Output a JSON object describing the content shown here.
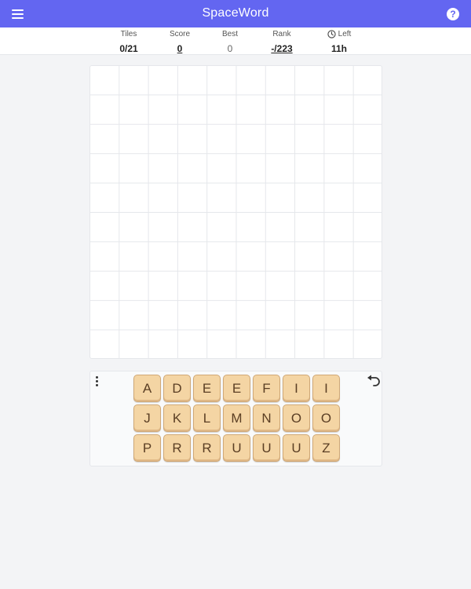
{
  "app": {
    "title": "SpaceWord",
    "header_color": "#6366f1",
    "menu_icon": "hamburger-menu-icon",
    "help_icon": "help-circle-icon",
    "help_glyph": "?"
  },
  "stats": {
    "tiles": {
      "label": "Tiles",
      "value": "0/21"
    },
    "score": {
      "label": "Score",
      "value": "0"
    },
    "best": {
      "label": "Best",
      "value": "0"
    },
    "rank": {
      "label": "Rank",
      "value": "-/223"
    },
    "left": {
      "label": "Left",
      "value": "11h",
      "icon": "clock-icon"
    }
  },
  "board": {
    "rows": 10,
    "cols": 10
  },
  "rack": {
    "menu_icon": "vertical-dots-icon",
    "undo_icon": "undo-icon",
    "tile_color": "#f4d5a4",
    "rows": [
      [
        "A",
        "D",
        "E",
        "E",
        "F",
        "I",
        "I"
      ],
      [
        "J",
        "K",
        "L",
        "M",
        "N",
        "O",
        "O"
      ],
      [
        "P",
        "R",
        "R",
        "U",
        "U",
        "U",
        "Z"
      ]
    ]
  }
}
